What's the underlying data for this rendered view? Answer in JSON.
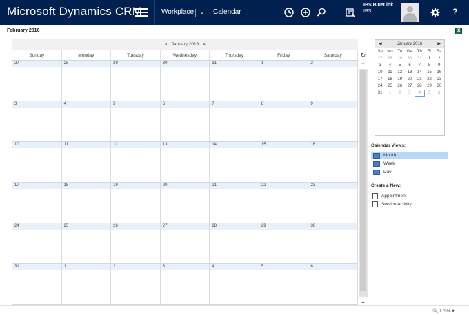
{
  "app": {
    "title": "Microsoft Dynamics CRM"
  },
  "nav": {
    "workplace": "Workplace",
    "calendar": "Calendar"
  },
  "user": {
    "org": "IBS BlueLink",
    "name": "IBS"
  },
  "page": {
    "title": "February 2016"
  },
  "calendar": {
    "month_label": "January 2016",
    "days_of_week": [
      "Sunday",
      "Monday",
      "Tuesday",
      "Wednesday",
      "Thursday",
      "Friday",
      "Saturday"
    ],
    "weeks": [
      [
        "27",
        "28",
        "29",
        "30",
        "31",
        "1",
        "2"
      ],
      [
        "3",
        "4",
        "5",
        "6",
        "7",
        "8",
        "9"
      ],
      [
        "10",
        "11",
        "12",
        "13",
        "14",
        "15",
        "16"
      ],
      [
        "17",
        "18",
        "19",
        "20",
        "21",
        "22",
        "23"
      ],
      [
        "24",
        "25",
        "26",
        "27",
        "28",
        "29",
        "30"
      ],
      [
        "31",
        "1",
        "2",
        "3",
        "4",
        "5",
        "6"
      ]
    ]
  },
  "mini_calendar": {
    "month_label": "January 2016",
    "day_headers": [
      "Su",
      "Mo",
      "Tu",
      "We",
      "Th",
      "Fr",
      "Sa"
    ],
    "weeks": [
      [
        "27",
        "28",
        "29",
        "30",
        "31",
        "1",
        "2"
      ],
      [
        "3",
        "4",
        "5",
        "6",
        "7",
        "8",
        "9"
      ],
      [
        "10",
        "11",
        "12",
        "13",
        "14",
        "15",
        "16"
      ],
      [
        "17",
        "18",
        "19",
        "20",
        "21",
        "22",
        "23"
      ],
      [
        "24",
        "25",
        "26",
        "27",
        "28",
        "29",
        "30"
      ],
      [
        "31",
        "1",
        "2",
        "3",
        "4",
        "5",
        "6"
      ]
    ]
  },
  "side": {
    "views_title": "Calendar Views:",
    "views": [
      "Month",
      "Week",
      "Day"
    ],
    "create_title": "Create a New:",
    "create": [
      "Appointment",
      "Service Activity"
    ]
  },
  "status": {
    "zoom": "175%"
  }
}
